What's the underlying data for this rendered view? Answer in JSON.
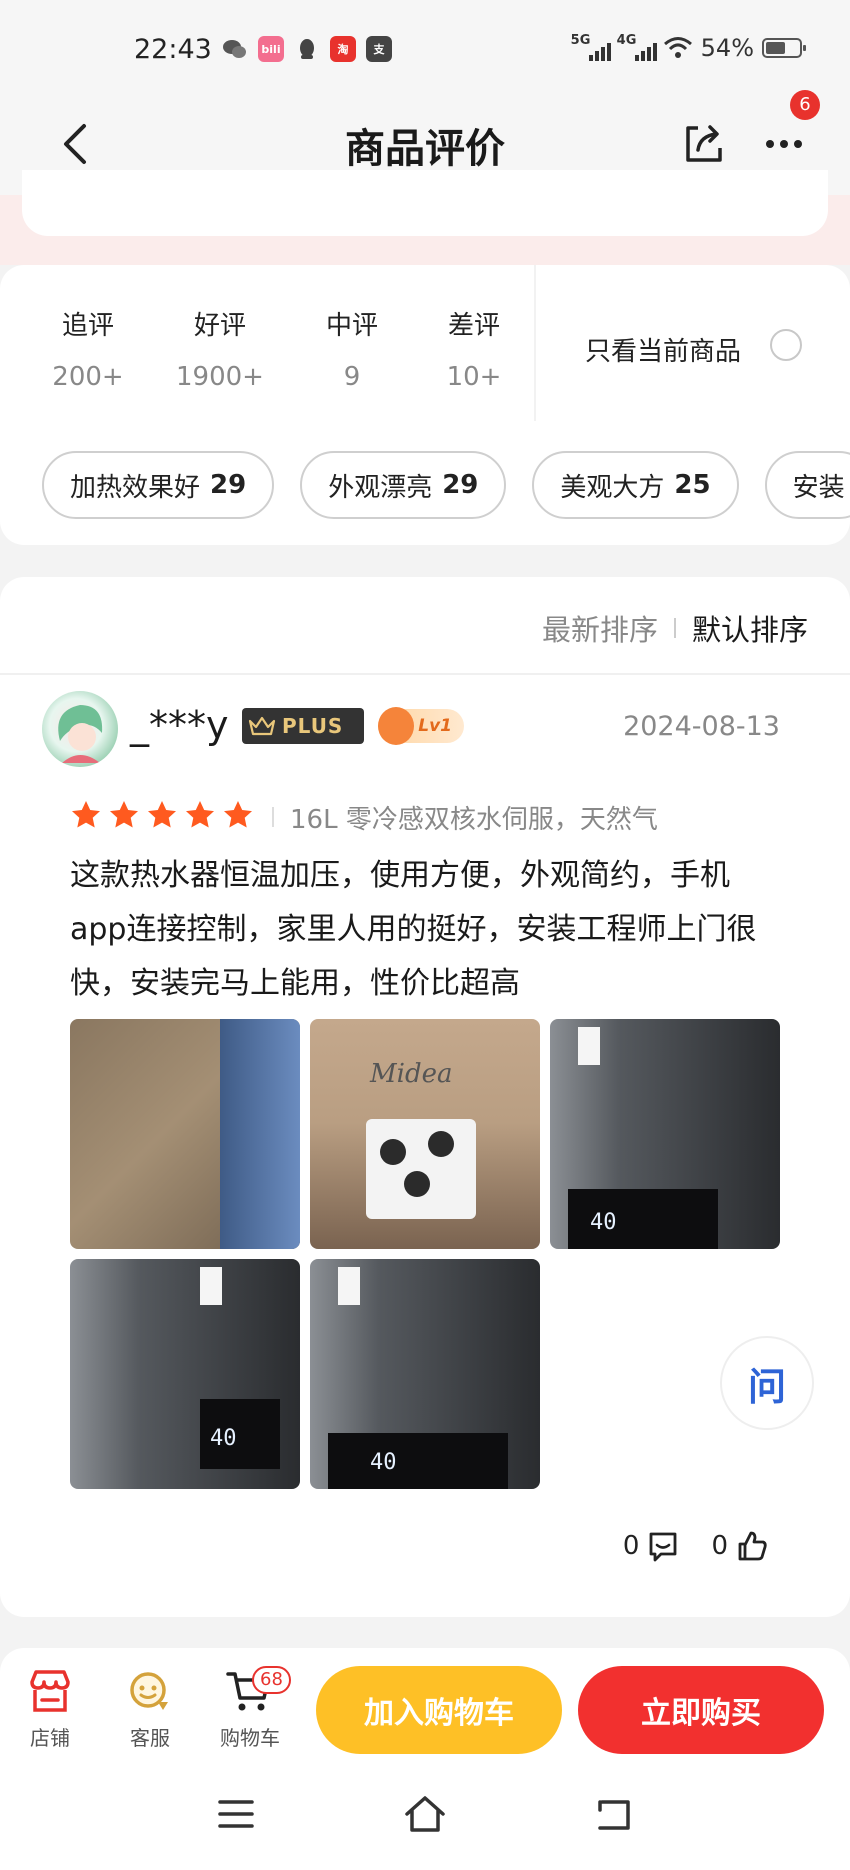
{
  "status_bar": {
    "time": "22:43",
    "app_icons": [
      {
        "name": "wechat-icon",
        "glyph": "",
        "color": "#555555"
      },
      {
        "name": "bilibili-icon",
        "glyph": "bili",
        "color": "#f36e8f"
      },
      {
        "name": "qq-icon",
        "glyph": "",
        "color": "#555555"
      },
      {
        "name": "taobao-icon",
        "glyph": "淘",
        "color": "#e8322d"
      },
      {
        "name": "alipay-icon",
        "glyph": "支",
        "color": "#555555"
      }
    ],
    "network_1": "5G",
    "network_2": "4G",
    "battery": "54%"
  },
  "nav": {
    "title": "商品评价",
    "more_badge": "6"
  },
  "filters": {
    "tabs": [
      {
        "label": "追评",
        "count": "200+"
      },
      {
        "label": "好评",
        "count": "1900+"
      },
      {
        "label": "中评",
        "count": "9"
      },
      {
        "label": "差评",
        "count": "10+"
      }
    ],
    "only_current": "只看当前商品",
    "only_current_checked": false,
    "chips": [
      {
        "label": "加热效果好",
        "count": "29"
      },
      {
        "label": "外观漂亮",
        "count": "29"
      },
      {
        "label": "美观大方",
        "count": "25"
      },
      {
        "label": "安装",
        "count": ""
      }
    ]
  },
  "sort": {
    "latest": "最新排序",
    "default": "默认排序",
    "active": "default"
  },
  "review": {
    "username": "_***y",
    "plus_label": "PLUS",
    "level_label": "Lv1",
    "date": "2024-08-13",
    "rating": 5,
    "spec": "16L 零冷感双核水伺服，天然气",
    "text": "这款热水器恒温加压，使用方便，外观简约，手机app连接控制，家里人用的挺好，安装工程师上门很快，安装完马上能用，性价比超高",
    "photos": [
      {
        "type": "box"
      },
      {
        "type": "midea",
        "logo_text": "Midea"
      },
      {
        "type": "heater",
        "display": "40"
      },
      {
        "type": "heater",
        "display": "40"
      },
      {
        "type": "heater",
        "display": "40"
      }
    ],
    "comment_count": "0",
    "like_count": "0"
  },
  "ask_button": "问",
  "bottom_bar": {
    "store": "店铺",
    "service": "客服",
    "cart": "购物车",
    "cart_badge": "68",
    "add_to_cart": "加入购物车",
    "buy_now": "立即购买"
  },
  "colors": {
    "accent_red": "#f2302f",
    "accent_yellow": "#fec026",
    "star": "#ff5a1f"
  }
}
